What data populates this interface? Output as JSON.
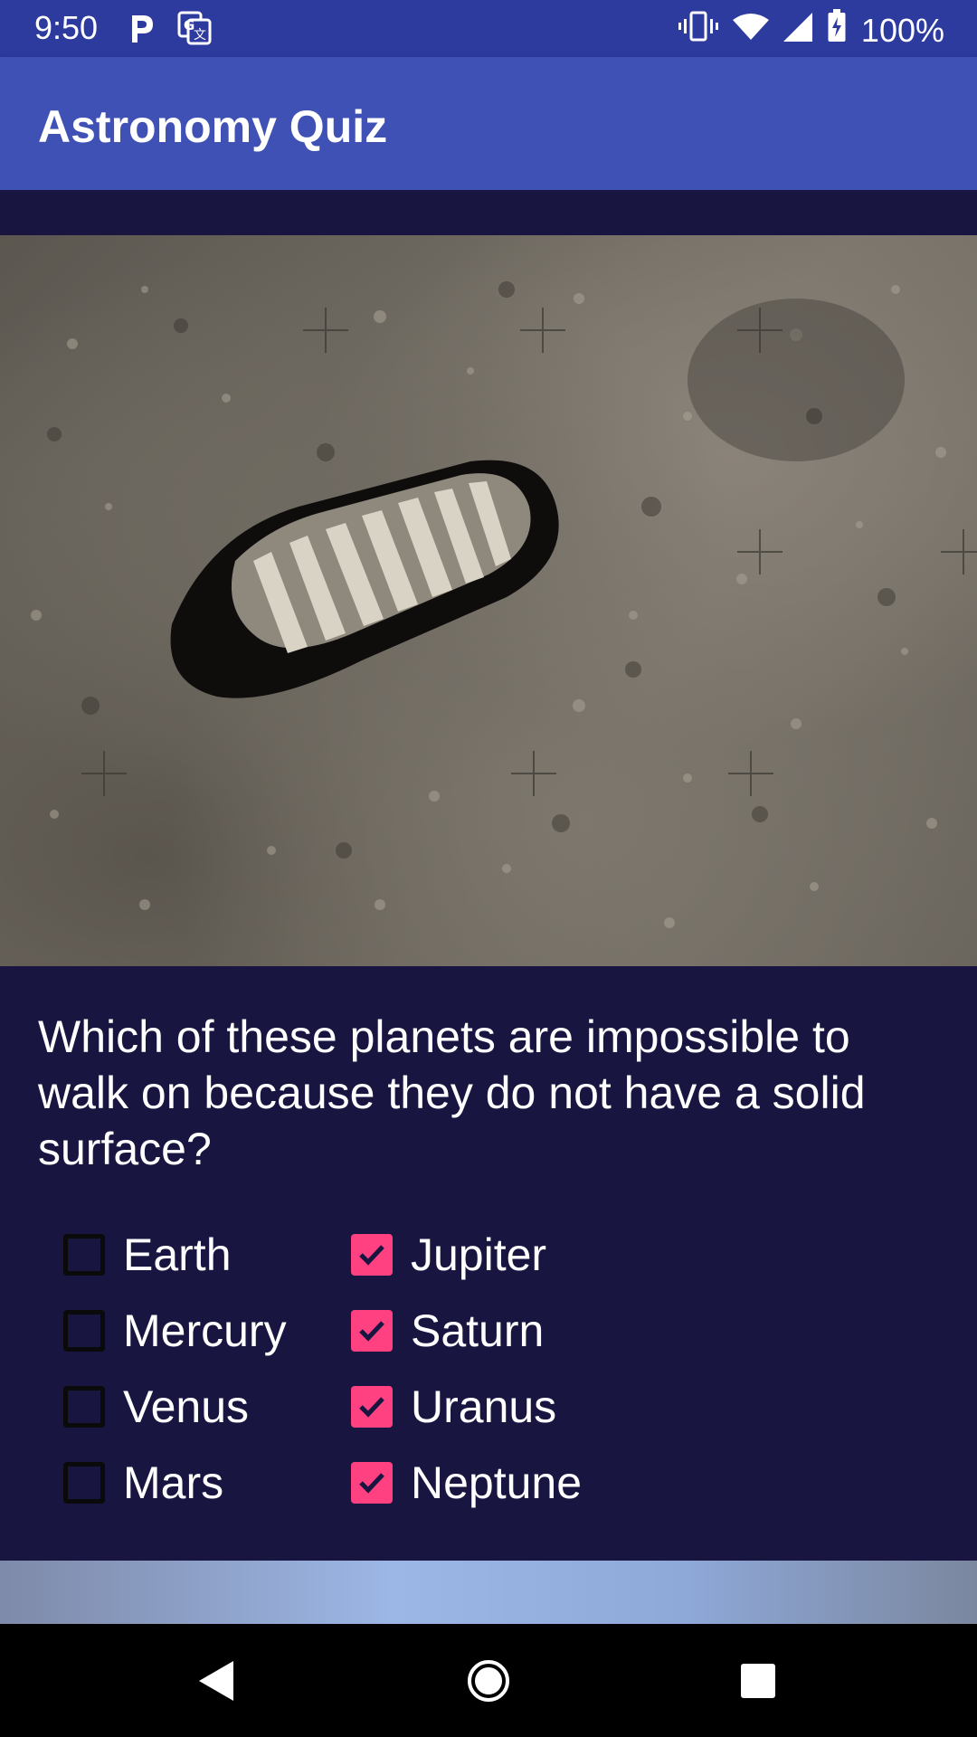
{
  "status_bar": {
    "time": "9:50",
    "battery": "100%",
    "icons": [
      "parking-icon",
      "translate-icon",
      "vibrate-icon",
      "wifi-icon",
      "signal-icon",
      "battery-charging-icon"
    ]
  },
  "app_bar": {
    "title": "Astronomy Quiz"
  },
  "question": {
    "text": "Which of these planets are impossible to walk on because they do not have a solid surface?"
  },
  "options": [
    {
      "label": "Earth",
      "checked": false
    },
    {
      "label": "Mercury",
      "checked": false
    },
    {
      "label": "Venus",
      "checked": false
    },
    {
      "label": "Mars",
      "checked": false
    },
    {
      "label": "Jupiter",
      "checked": true
    },
    {
      "label": "Saturn",
      "checked": true
    },
    {
      "label": "Uranus",
      "checked": true
    },
    {
      "label": "Neptune",
      "checked": true
    }
  ],
  "colors": {
    "status_bar": "#2d3a9e",
    "app_bar": "#3f51b5",
    "background": "#181641",
    "checkbox_checked": "#ff4081"
  },
  "nav_bar": {
    "icons": [
      "back-icon",
      "home-icon",
      "recents-icon"
    ]
  }
}
